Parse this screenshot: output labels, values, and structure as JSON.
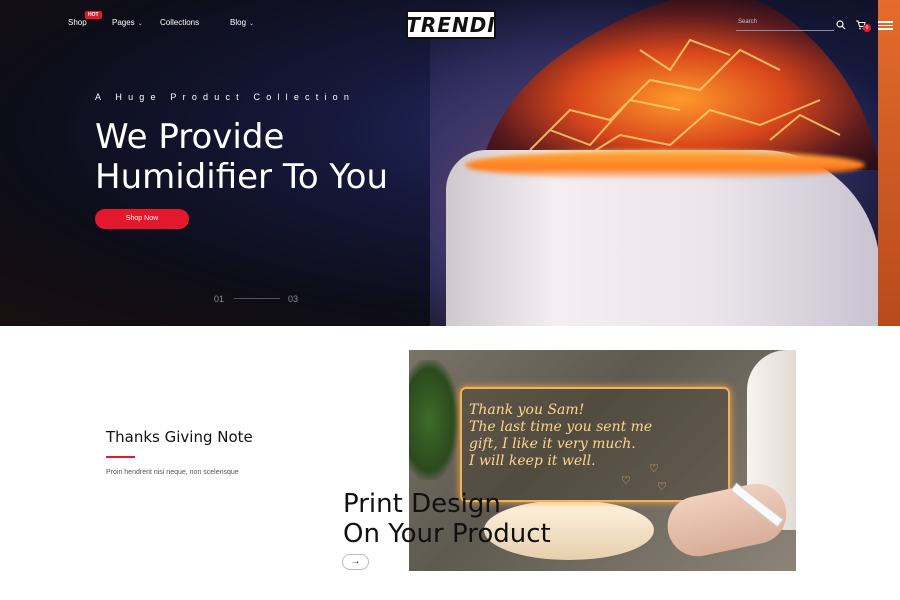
{
  "nav": {
    "items": [
      {
        "label": "Shop",
        "has_dropdown": false
      },
      {
        "label": "Pages",
        "has_dropdown": true
      },
      {
        "label": "Collections",
        "has_dropdown": false
      },
      {
        "label": "Blog",
        "has_dropdown": true
      }
    ],
    "badge": "HOT",
    "logo": "TRENDI",
    "search_placeholder": "Search",
    "cart_count": "0",
    "icons": {
      "search": "search-icon",
      "cart": "cart-icon",
      "menu": "hamburger-icon"
    }
  },
  "hero": {
    "eyebrow": "A Huge Product Collection",
    "headline_line1": "We Provide",
    "headline_line2": "Humidifier To You",
    "button": "Shop Now",
    "slide_current": "01",
    "slide_total": "03"
  },
  "feature": {
    "title": "Thanks Giving Note",
    "description": "Proin hendrerit nisi neque, non scelerisque",
    "print_line1": "Print Design",
    "print_line2": "On Your Product",
    "arrow_icon": "arrow-right-icon",
    "board_text": [
      "Thank you Sam!",
      "The last time you sent me",
      "gift, I like it very much.",
      "I will keep it well."
    ]
  },
  "colors": {
    "accent": "#e3182d",
    "hero_bg": "#15183a",
    "text_dark": "#111111"
  }
}
